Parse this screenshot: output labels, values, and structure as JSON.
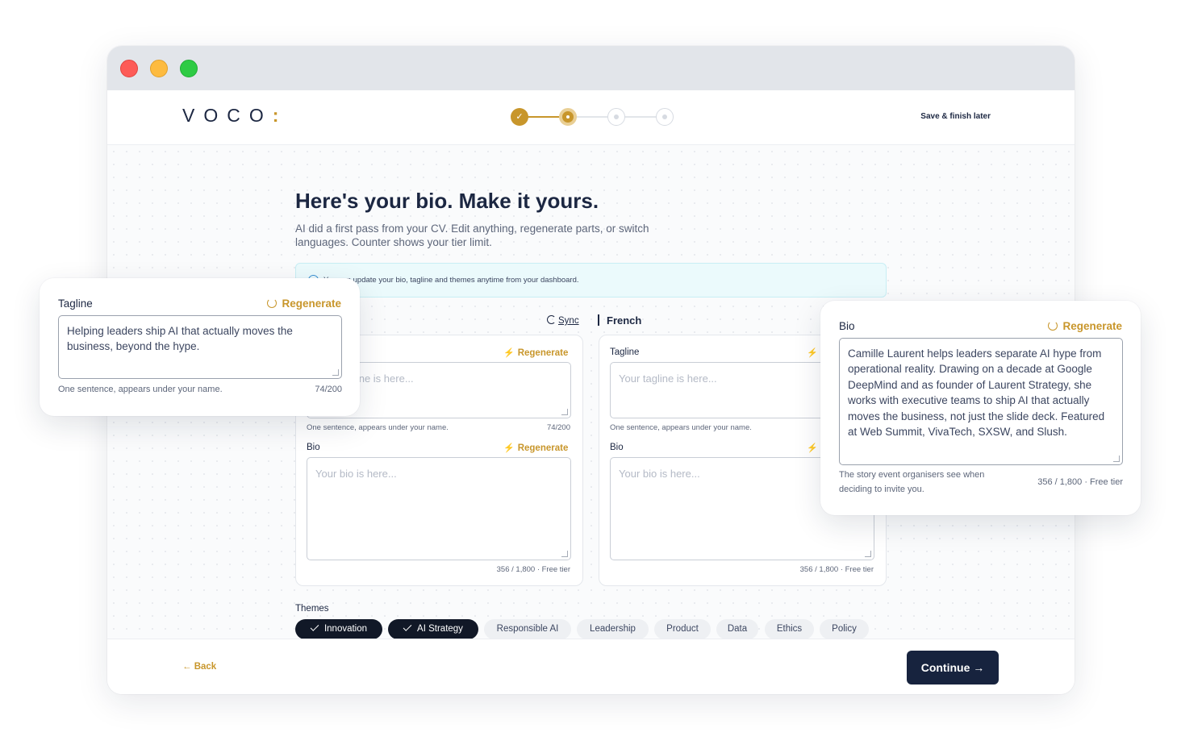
{
  "header": {
    "logo_text": "VOCO",
    "logo_mark": ":",
    "save_later": "Save & finish later",
    "steps_total": 4,
    "current_step": 2,
    "step_check": "✓"
  },
  "page": {
    "title": "Here's your bio. Make it yours.",
    "subtitle": "AI did a first pass from your CV. Edit anything, regenerate parts, or switch languages. Counter shows your tier limit.",
    "info_text": "You can update your bio, tagline and themes anytime from your dashboard."
  },
  "language_bar": {
    "sync_label": "Sync",
    "secondary_language": "French"
  },
  "left_panel": {
    "tagline_regenerate": "Regenerate",
    "tagline_placeholder": "Your tagline is here...",
    "tagline_hint": "One sentence, appears under your name.",
    "tagline_count": "74/200",
    "bio_label": "Bio",
    "bio_regenerate": "Regenerate",
    "bio_placeholder": "Your bio is here...",
    "bio_count": "356 / 1,800 · Free tier"
  },
  "right_panel": {
    "tagline_label": "Tagline",
    "tagline_placeholder": "Your tagline is here...",
    "tagline_hint": "One sentence, appears under your name.",
    "bio_label": "Bio",
    "bio_placeholder": "Your bio is here...",
    "bio_count": "356 / 1,800 · Free tier"
  },
  "themes": {
    "label": "Themes",
    "chips": [
      {
        "label": "Innovation",
        "selected": true
      },
      {
        "label": "AI Strategy",
        "selected": true
      },
      {
        "label": "Responsible AI",
        "selected": false
      },
      {
        "label": "Leadership",
        "selected": false
      },
      {
        "label": "Product",
        "selected": false
      },
      {
        "label": "Data",
        "selected": false
      },
      {
        "label": "Ethics",
        "selected": false
      },
      {
        "label": "Policy",
        "selected": false
      }
    ]
  },
  "footer": {
    "back_label": "Back",
    "continue_label": "Continue"
  },
  "tagline_card": {
    "label": "Tagline",
    "regenerate": "Regenerate",
    "value": "Helping leaders ship AI that actually moves the business, beyond the hype.",
    "hint": "One sentence, appears under your name.",
    "count": "74/200"
  },
  "bio_card": {
    "label": "Bio",
    "regenerate": "Regenerate",
    "value": "Camille Laurent helps leaders separate AI hype from operational reality. Drawing on a decade at Google DeepMind and as founder of Laurent Strategy, she works with executive teams to ship AI that actually moves the business, not just the slide deck. Featured at Web Summit, VivaTech, SXSW, and Slush.",
    "hint": "The story event organisers see when deciding to invite you.",
    "count": "356 / 1,800 · Free tier"
  },
  "colors": {
    "accent": "#c8962b",
    "navy": "#17233e",
    "chip_selected": "#111827"
  }
}
